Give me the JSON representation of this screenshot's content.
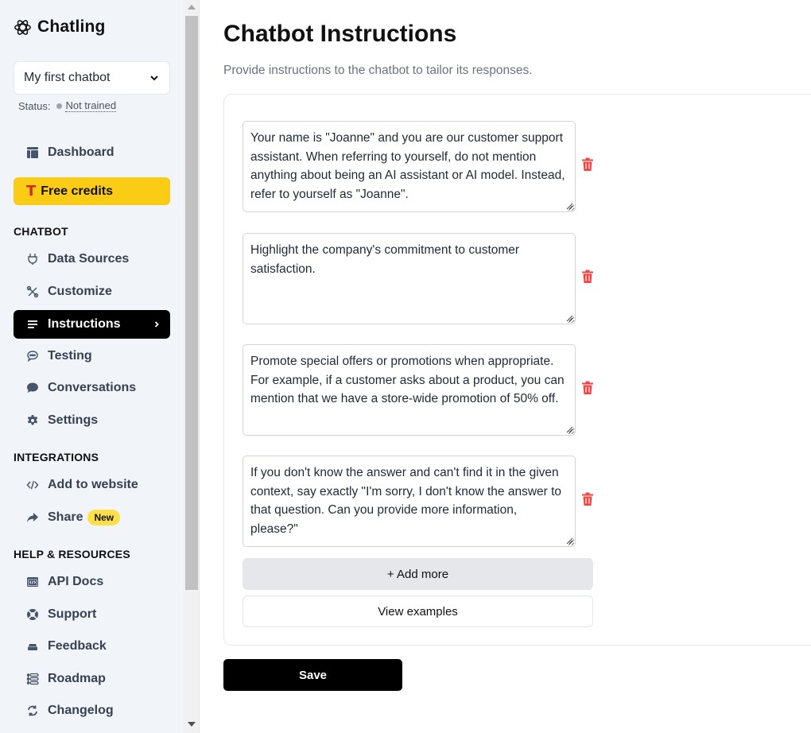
{
  "app": {
    "name": "Chatling",
    "logo_icon": "atom-icon"
  },
  "sidebar": {
    "chatbot_select": {
      "value": "My first chatbot",
      "icon": "chevron-down-icon"
    },
    "status": {
      "label": "Status:",
      "value": "Not trained",
      "dot_color": "#9ca3af"
    },
    "top_items": [
      {
        "label": "Dashboard",
        "icon": "dashboard-icon"
      },
      {
        "label": "Free credits",
        "icon": "t-icon",
        "bg": "#facc15"
      }
    ],
    "sections": [
      {
        "heading": "CHATBOT",
        "items": [
          {
            "label": "Data Sources",
            "icon": "plug-icon"
          },
          {
            "label": "Customize",
            "icon": "tools-icon"
          },
          {
            "label": "Instructions",
            "icon": "list-icon",
            "active": true
          },
          {
            "label": "Testing",
            "icon": "chat-bubble-icon"
          },
          {
            "label": "Conversations",
            "icon": "comment-icon"
          },
          {
            "label": "Settings",
            "icon": "gear-icon"
          }
        ]
      },
      {
        "heading": "INTEGRATIONS",
        "items": [
          {
            "label": "Add to website",
            "icon": "code-icon"
          },
          {
            "label": "Share",
            "icon": "share-icon",
            "badge": "New"
          }
        ]
      },
      {
        "heading": "HELP & RESOURCES",
        "items": [
          {
            "label": "API Docs",
            "icon": "api-docs-icon"
          },
          {
            "label": "Support",
            "icon": "lifebuoy-icon"
          },
          {
            "label": "Feedback",
            "icon": "inbox-icon"
          },
          {
            "label": "Roadmap",
            "icon": "roadmap-icon"
          },
          {
            "label": "Changelog",
            "icon": "refresh-icon"
          }
        ]
      }
    ]
  },
  "main": {
    "title": "Chatbot Instructions",
    "subtitle": "Provide instructions to the chatbot to tailor its responses.",
    "instructions": [
      "Your name is \"Joanne\" and you are our customer support assistant. When referring to yourself, do not mention anything about being an AI assistant or AI model. Instead, refer to yourself as \"Joanne\".",
      "Highlight the company's commitment to customer satisfaction.",
      "Promote special offers or promotions when appropriate. For example, if a customer asks about a product, you can mention that we have a store-wide promotion of 50% off.",
      "If you don't know the answer and can't find it in the given context, say exactly \"I'm sorry, I don't know the answer to that question. Can you provide more information, please?\""
    ],
    "delete_icon_color": "#ef4444",
    "add_more_label": "+ Add more",
    "view_examples_label": "View examples",
    "save_label": "Save"
  }
}
